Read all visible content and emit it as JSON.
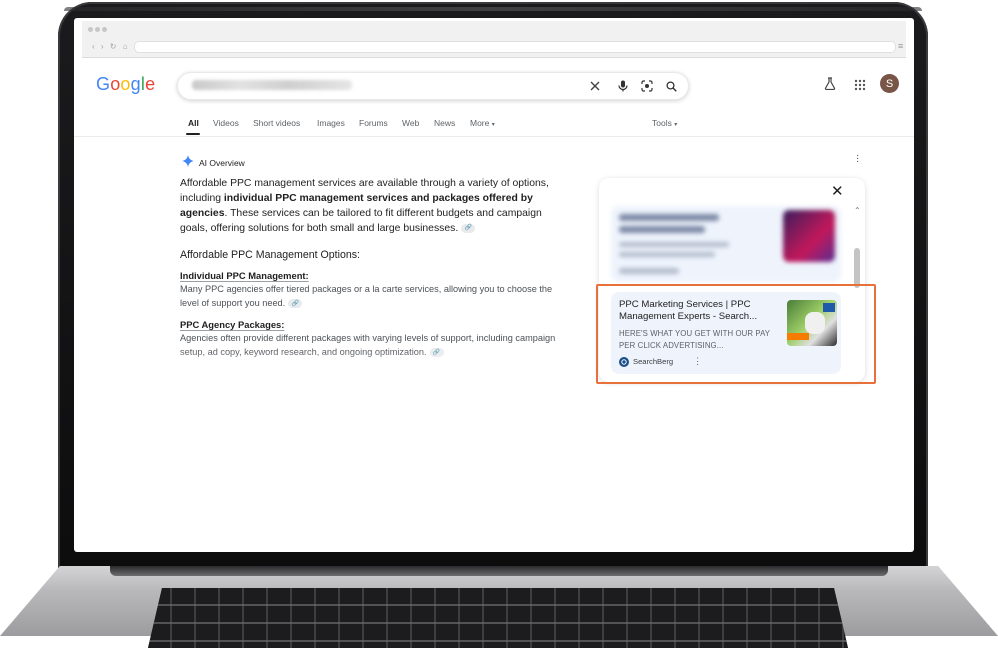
{
  "google": {
    "logo_letters": [
      {
        "char": "G",
        "color": "#4285F4"
      },
      {
        "char": "o",
        "color": "#EA4335"
      },
      {
        "char": "o",
        "color": "#FBBC05"
      },
      {
        "char": "g",
        "color": "#4285F4"
      },
      {
        "char": "l",
        "color": "#34A853"
      },
      {
        "char": "e",
        "color": "#EA4335"
      }
    ]
  },
  "search": {
    "icons": [
      "close-icon",
      "mic-icon",
      "lens-icon",
      "search-icon"
    ]
  },
  "header": {
    "avatar_initial": "S",
    "icons": [
      "labs-icon",
      "apps-icon"
    ]
  },
  "tabs": [
    {
      "label": "All",
      "active": true
    },
    {
      "label": "Videos"
    },
    {
      "label": "Short videos"
    },
    {
      "label": "Images"
    },
    {
      "label": "Forums"
    },
    {
      "label": "Web"
    },
    {
      "label": "News"
    },
    {
      "label": "More"
    }
  ],
  "tools_label": "Tools",
  "ai_overview": {
    "title": "AI Overview",
    "summary_parts": [
      "Affordable PPC management services are available through a variety of options, including ",
      "individual PPC management services and packages offered by agencies",
      ". These services can be tailored to fit different budgets and campaign goals, offering solutions for both small and large businesses."
    ],
    "heading": "Affordable PPC Management Options:",
    "sections": [
      {
        "heading": "Individual PPC Management:",
        "text": "Many PPC agencies offer tiered packages or a la carte services, allowing you to choose the level of support you need."
      },
      {
        "heading": "PPC Agency Packages:",
        "text": "Agencies often provide different packages with varying levels of support, including campaign setup, ad copy, keyword research, and ongoing optimization."
      }
    ]
  },
  "sources_panel": {
    "highlighted_source": {
      "title": "PPC Marketing Services | PPC Management Experts - Search...",
      "snippet": "HERE'S WHAT YOU GET WITH OUR PAY PER CLICK ADVERTISING...",
      "site_name": "SearchBerg"
    }
  },
  "colors": {
    "highlight": "#e8703a",
    "card_bg": "#eef3fc",
    "ai_star": "#4285F4"
  }
}
